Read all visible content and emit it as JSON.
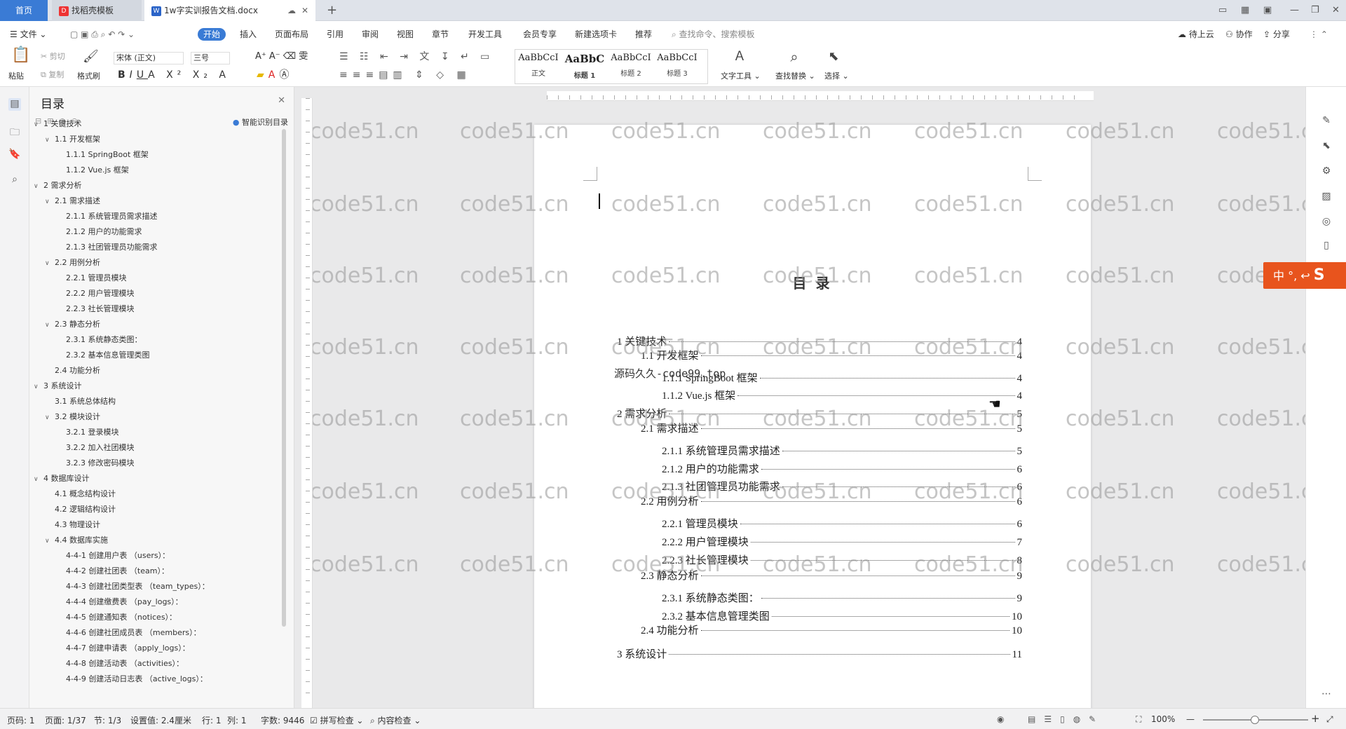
{
  "tabs": {
    "home": "首页",
    "template": "找稻壳模板",
    "doc": "1w字实训报告文档.docx",
    "add": "+"
  },
  "menubar": {
    "file": "文件",
    "items": [
      "开始",
      "插入",
      "页面布局",
      "引用",
      "审阅",
      "视图",
      "章节",
      "开发工具",
      "会员专享",
      "新建选项卡",
      "推荐"
    ],
    "search_placeholder": "查找命令、搜索模板",
    "cloud": "待上云",
    "collab": "协作",
    "share": "分享"
  },
  "ribbon": {
    "paste": "粘贴",
    "cut": "剪切",
    "copy": "复制",
    "format_painter": "格式刷",
    "font": "宋体 (正文)",
    "size": "三号",
    "styles": [
      {
        "sample": "AaBbCcI",
        "label": "正文"
      },
      {
        "sample": "AaBbC",
        "label": "标题 1"
      },
      {
        "sample": "AaBbCcI",
        "label": "标题 2"
      },
      {
        "sample": "AaBbCcI",
        "label": "标题 3"
      }
    ],
    "text_tools": "文字工具",
    "find_replace": "查找替换",
    "select": "选择"
  },
  "toc_panel": {
    "title": "目录",
    "smart": "智能识别目录",
    "items": [
      {
        "text": "1  关键技术",
        "level": 0,
        "chevron": true
      },
      {
        "text": "1.1  开发框架",
        "level": 1,
        "chevron": true
      },
      {
        "text": "1.1.1 SpringBoot  框架",
        "level": 2,
        "chevron": false
      },
      {
        "text": "1.1.2 Vue.js  框架",
        "level": 2,
        "chevron": false
      },
      {
        "text": "2  需求分析",
        "level": 0,
        "chevron": true
      },
      {
        "text": "2.1 需求描述",
        "level": 1,
        "chevron": true
      },
      {
        "text": "2.1.1 系统管理员需求描述",
        "level": 2,
        "chevron": false
      },
      {
        "text": "2.1.2 用户的功能需求",
        "level": 2,
        "chevron": false
      },
      {
        "text": "2.1.3 社团管理员功能需求",
        "level": 2,
        "chevron": false
      },
      {
        "text": "2.2 用例分析",
        "level": 1,
        "chevron": true
      },
      {
        "text": "2.2.1 管理员模块",
        "level": 2,
        "chevron": false
      },
      {
        "text": "2.2.2 用户管理模块",
        "level": 2,
        "chevron": false
      },
      {
        "text": "2.2.3 社长管理模块",
        "level": 2,
        "chevron": false
      },
      {
        "text": "2.3 静态分析",
        "level": 1,
        "chevron": true
      },
      {
        "text": "2.3.1 系统静态类图：",
        "level": 2,
        "chevron": false
      },
      {
        "text": "2.3.2 基本信息管理类图",
        "level": 2,
        "chevron": false
      },
      {
        "text": "2.4 功能分析",
        "level": 1,
        "chevron": false
      },
      {
        "text": "3  系统设计",
        "level": 0,
        "chevron": true
      },
      {
        "text": "3.1 系统总体结构",
        "level": 1,
        "chevron": false
      },
      {
        "text": "3.2 模块设计",
        "level": 1,
        "chevron": true
      },
      {
        "text": "3.2.1 登录模块",
        "level": 2,
        "chevron": false
      },
      {
        "text": "3.2.2 加入社团模块",
        "level": 2,
        "chevron": false
      },
      {
        "text": "3.2.3 修改密码模块",
        "level": 2,
        "chevron": false
      },
      {
        "text": "4  数据库设计",
        "level": 0,
        "chevron": true
      },
      {
        "text": "4.1 概念结构设计",
        "level": 1,
        "chevron": false
      },
      {
        "text": "4.2 逻辑结构设计",
        "level": 1,
        "chevron": false
      },
      {
        "text": "4.3 物理设计",
        "level": 1,
        "chevron": false
      },
      {
        "text": "4.4  数据库实施",
        "level": 1,
        "chevron": true
      },
      {
        "text": "4-4-1 创建用户表  （users）：",
        "level": 2,
        "chevron": false
      },
      {
        "text": "4-4-2 创建社团表  （team）：",
        "level": 2,
        "chevron": false
      },
      {
        "text": "4-4-3 创建社团类型表  （team_types）：",
        "level": 2,
        "chevron": false
      },
      {
        "text": "4-4-4 创建缴费表  （pay_logs）：",
        "level": 2,
        "chevron": false
      },
      {
        "text": "4-4-5 创建通知表  （notices）：",
        "level": 2,
        "chevron": false
      },
      {
        "text": "4-4-6 创建社团成员表  （members）：",
        "level": 2,
        "chevron": false
      },
      {
        "text": "4-4-7 创建申请表  （apply_logs）：",
        "level": 2,
        "chevron": false
      },
      {
        "text": "4-4-8 创建活动表  （activities）：",
        "level": 2,
        "chevron": false
      },
      {
        "text": "4-4-9 创建活动日志表  （active_logs）：",
        "level": 2,
        "chevron": false
      }
    ]
  },
  "document": {
    "heading": "目  录",
    "watermark_text": "源码久久-code99.top",
    "lines": [
      {
        "text": "1  关键技术",
        "page": "4",
        "indent": 0
      },
      {
        "text": "1.1  开发框架",
        "page": "4",
        "indent": 1
      },
      {
        "text": "1.1.1 SpringBoot  框架",
        "page": "4",
        "indent": 2
      },
      {
        "text": "1.1.2 Vue.js  框架",
        "page": "4",
        "indent": 2
      },
      {
        "text": "2  需求分析",
        "page": "5",
        "indent": 0
      },
      {
        "text": "2.1 需求描述",
        "page": "5",
        "indent": 1
      },
      {
        "text": "2.1.1 系统管理员需求描述",
        "page": "5",
        "indent": 2
      },
      {
        "text": "2.1.2 用户的功能需求",
        "page": "6",
        "indent": 2
      },
      {
        "text": "2.1.3 社团管理员功能需求",
        "page": "6",
        "indent": 2
      },
      {
        "text": "2.2 用例分析",
        "page": "6",
        "indent": 1
      },
      {
        "text": "2.2.1 管理员模块",
        "page": "6",
        "indent": 2
      },
      {
        "text": "2.2.2 用户管理模块",
        "page": "7",
        "indent": 2
      },
      {
        "text": "2.2.3 社长管理模块",
        "page": "8",
        "indent": 2
      },
      {
        "text": "2.3 静态分析",
        "page": "9",
        "indent": 1
      },
      {
        "text": "2.3.1 系统静态类图：",
        "page": "9",
        "indent": 2
      },
      {
        "text": "2.3.2 基本信息管理类图",
        "page": "10",
        "indent": 2
      },
      {
        "text": "2.4 功能分析",
        "page": "10",
        "indent": 1
      },
      {
        "text": "3  系统设计",
        "page": "11",
        "indent": 0
      }
    ]
  },
  "ime": "中 °, ↩",
  "watermark": "code51.cn",
  "statusbar": {
    "page_code": "页码: 1",
    "page": "页面: 1/37",
    "section": "节: 1/3",
    "setting": "设置值: 2.4厘米",
    "row": "行: 1",
    "col": "列: 1",
    "words": "字数: 9446",
    "spell": "拼写检查",
    "content": "内容检查",
    "zoom": "100%"
  },
  "colors": {
    "accent": "#3a7bd5",
    "ime": "#e8541d"
  }
}
